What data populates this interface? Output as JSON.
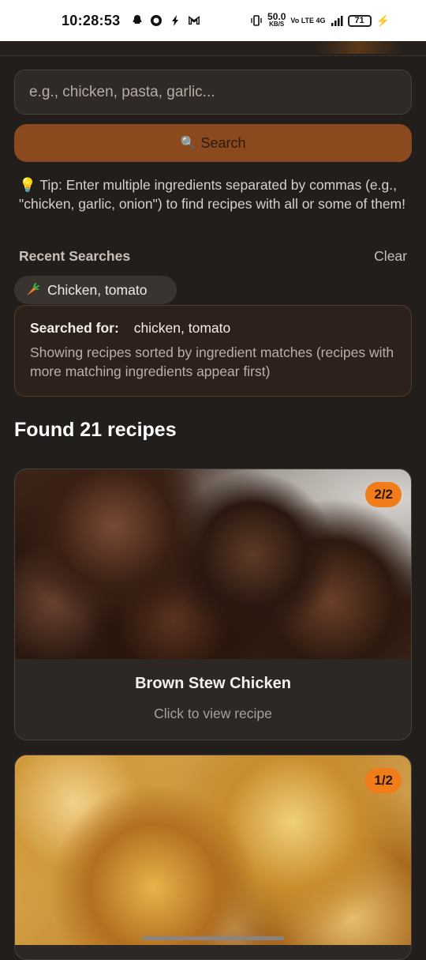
{
  "status_bar": {
    "time": "10:28:53",
    "net_speed": "50.0",
    "net_unit": "KB/S",
    "network": "Vo LTE 4G",
    "battery": "71"
  },
  "search": {
    "placeholder": "e.g., chicken, pasta, garlic...",
    "button_label": "Search",
    "button_icon": "🔍"
  },
  "tip": "💡 Tip: Enter multiple ingredients separated by commas (e.g., \"chicken, garlic, onion\") to find recipes with all or some of them!",
  "recent": {
    "title": "Recent Searches",
    "clear_label": "Clear",
    "items": [
      {
        "icon": "carrot-icon",
        "label": "Chicken, tomato"
      }
    ]
  },
  "searched": {
    "label": "Searched for:",
    "query": "chicken, tomato",
    "description": "Showing recipes sorted by ingredient matches (recipes with more matching ingredients appear first)"
  },
  "results": {
    "found_text": "Found 21 recipes",
    "cards": [
      {
        "title": "Brown Stew Chicken",
        "subtitle": "Click to view recipe",
        "match": "2/2"
      },
      {
        "title": "",
        "subtitle": "",
        "match": "1/2"
      }
    ]
  },
  "colors": {
    "background": "#221e1c",
    "accent": "#8a4a1d",
    "badge": "#f07c1a"
  }
}
